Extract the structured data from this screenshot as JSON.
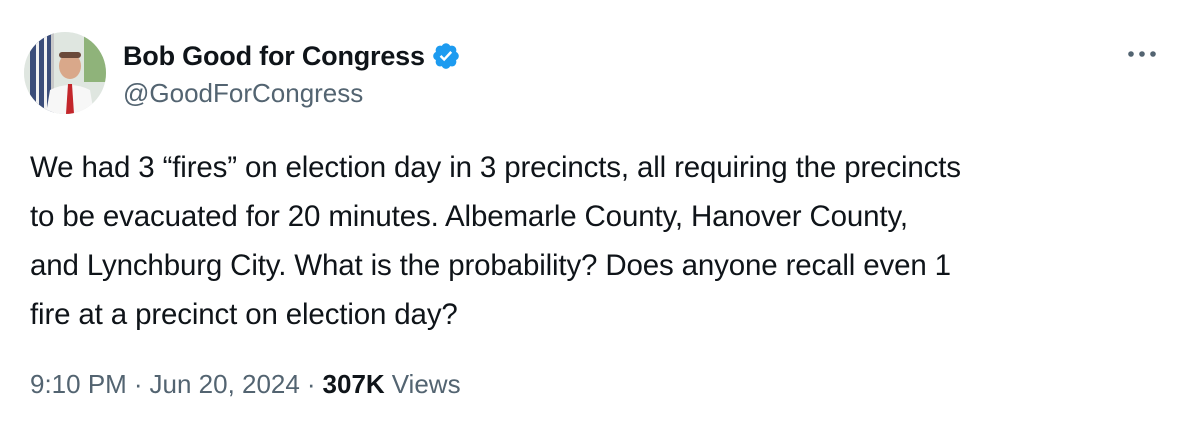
{
  "author": {
    "display_name": "Bob Good for Congress",
    "handle": "@GoodForCongress",
    "verified_icon": "verified-badge-icon",
    "avatar_icon": "avatar"
  },
  "tweet": {
    "text": "We had 3 “fires” on election day in 3 precincts, all requiring the precincts\nto be evacuated for 20 minutes.  Albemarle County, Hanover County,\nand Lynchburg City.  What is the probability?  Does anyone recall even 1\nfire at a precinct on election day?",
    "time": "9:10 PM",
    "date": "Jun 20, 2024",
    "separator": "·",
    "views_count": "307K",
    "views_label": "Views"
  },
  "colors": {
    "text_primary": "#0f1419",
    "text_secondary": "#536471",
    "verified_blue": "#1d9bf0"
  },
  "more_icon": "more-horizontal-icon"
}
